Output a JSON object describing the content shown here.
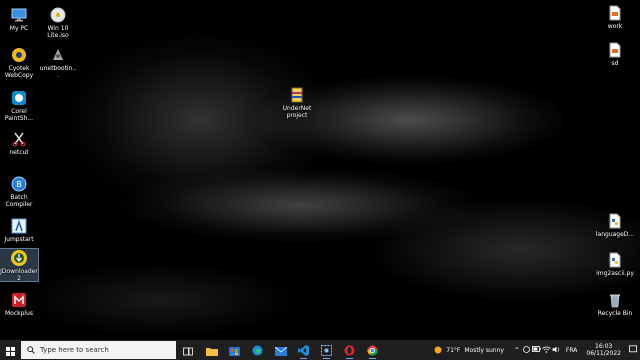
{
  "desktop": {
    "icons_left": [
      {
        "label": "My PC",
        "icon": "computer-icon"
      },
      {
        "label": "Cyotek WebCopy",
        "icon": "webcopy-icon"
      },
      {
        "label": "Corel PaintSh...",
        "icon": "paintshop-icon"
      },
      {
        "label": "netcut",
        "icon": "scissors-icon"
      },
      {
        "label": "Batch Compiler",
        "icon": "batch-compiler-icon"
      },
      {
        "label": "Jumpstart",
        "icon": "jumpstart-icon"
      },
      {
        "label": "JDownloader 2",
        "icon": "jdownloader-icon"
      },
      {
        "label": "Mockplus",
        "icon": "mockplus-icon"
      }
    ],
    "icons_col2": [
      {
        "label": "Win 10 Lite.iso",
        "icon": "disc-image-icon"
      },
      {
        "label": "unetbootin...",
        "icon": "unetbootin-icon"
      }
    ],
    "icon_center": {
      "label": "UnderNet project",
      "icon": "winrar-archive-icon"
    },
    "icons_right": [
      {
        "label": "work",
        "icon": "document-icon"
      },
      {
        "label": "sd",
        "icon": "document-icon"
      },
      {
        "label": "languageD...",
        "icon": "python-file-icon"
      },
      {
        "label": "img2ascii.py",
        "icon": "python-file-icon"
      },
      {
        "label": "Recycle Bin",
        "icon": "recycle-bin-icon"
      }
    ]
  },
  "taskbar": {
    "search_placeholder": "Type here to search",
    "pinned": [
      "file-explorer-icon",
      "store-icon",
      "edge-icon",
      "mail-icon",
      "vscode-icon",
      "snipping-tool-icon",
      "opera-icon",
      "chrome-icon"
    ],
    "weather": {
      "temp": "71°F",
      "condition": "Mostly sunny"
    },
    "language": "FRA",
    "time": "16:03",
    "date": "06/11/2022"
  }
}
